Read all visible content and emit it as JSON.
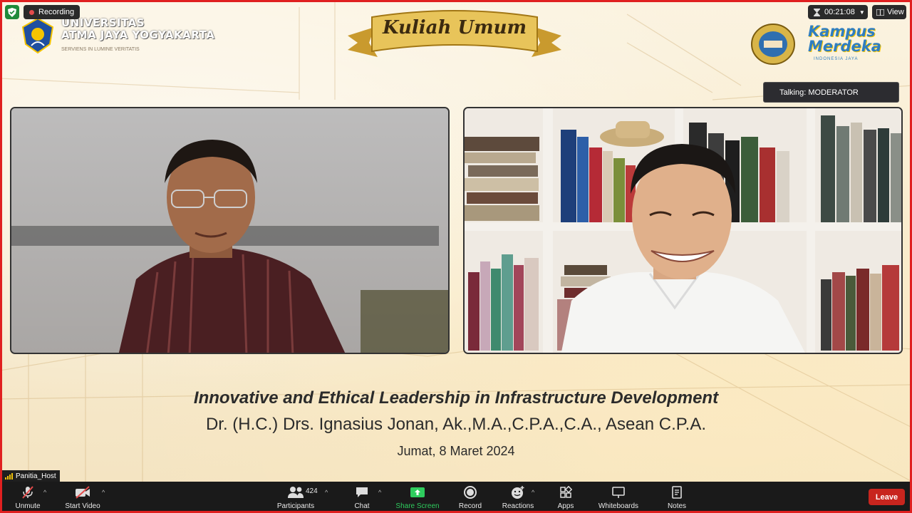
{
  "top_left": {
    "recording_label": "Recording"
  },
  "branding": {
    "university_line1": "UNIVERSITAS",
    "university_line2": "ATMA JAYA YOGYAKARTA",
    "university_tagline": "SERVIENS IN LUMINE VERITATIS",
    "event_banner": "Kuliah Umum",
    "kampus_line1": "Kampus",
    "kampus_line2": "Merdeka",
    "kampus_sub": "INDONESIA JAYA"
  },
  "top_right": {
    "timer": "00:21:08",
    "view_label": "View",
    "talking": "Talking: MODERATOR"
  },
  "captions": {
    "title": "Innovative and Ethical Leadership in Infrastructure Development",
    "speaker": "Dr. (H.C.) Drs. Ignasius Jonan, Ak.,M.A.,C.P.A.,C.A., Asean C.P.A.",
    "date": "Jumat, 8 Maret 2024"
  },
  "self_view": {
    "name": "Panitia_Host"
  },
  "toolbar": {
    "unmute": "Unmute",
    "start_video": "Start Video",
    "participants": "Participants",
    "participant_count": "424",
    "chat": "Chat",
    "share_screen": "Share Screen",
    "record": "Record",
    "reactions": "Reactions",
    "apps": "Apps",
    "whiteboards": "Whiteboards",
    "notes": "Notes",
    "leave": "Leave"
  },
  "colors": {
    "recording_frame": "#e02020",
    "share_green": "#2ecc5e",
    "leave_red": "#c8251e",
    "toolbar_bg": "#1a1a1a"
  }
}
